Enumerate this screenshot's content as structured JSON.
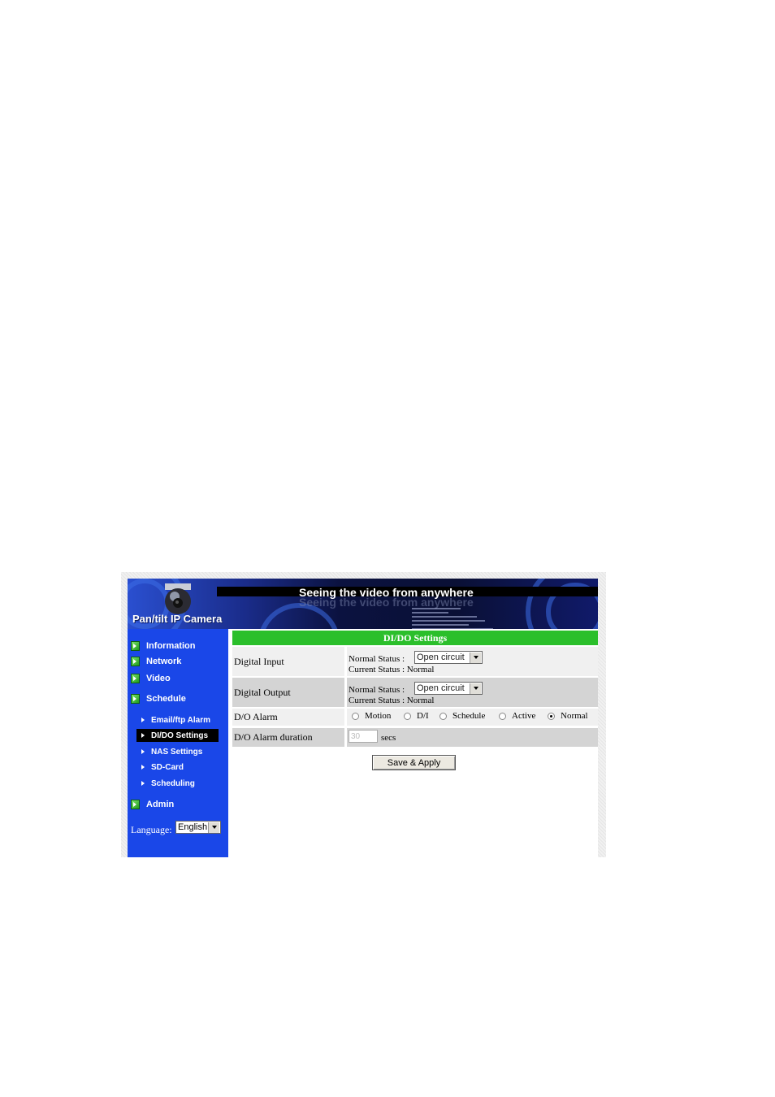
{
  "banner": {
    "headline": "Seeing the video from anywhere",
    "brand": "Pan/tilt IP Camera"
  },
  "sidebar": {
    "main_items": [
      {
        "label": "Information",
        "icon": "green-arrow-icon"
      },
      {
        "label": "Network",
        "icon": "green-arrow-icon"
      },
      {
        "label": "Video",
        "icon": "green-arrow-icon"
      },
      {
        "label": "Schedule",
        "icon": "green-arrow-icon"
      },
      {
        "label": "Admin",
        "icon": "green-arrow-icon"
      }
    ],
    "sub_items": [
      {
        "label": "Email/ftp Alarm"
      },
      {
        "label": "DI/DO Settings",
        "active": true
      },
      {
        "label": "NAS Settings"
      },
      {
        "label": "SD-Card"
      },
      {
        "label": "Scheduling"
      }
    ],
    "language_label": "Language:",
    "language_value": "English"
  },
  "settings": {
    "title": "DI/DO Settings",
    "digital_input": {
      "label": "Digital Input",
      "normal_status_label": "Normal Status :",
      "normal_status_value": "Open circuit",
      "current_status_text": "Current Status : Normal"
    },
    "digital_output": {
      "label": "Digital Output",
      "normal_status_label": "Normal Status :",
      "normal_status_value": "Open circuit",
      "current_status_text": "Current Status : Normal"
    },
    "do_alarm": {
      "label": "D/O Alarm",
      "options": [
        "Motion",
        "D/I",
        "Schedule",
        "Active",
        "Normal"
      ],
      "selected": "Normal"
    },
    "do_alarm_duration": {
      "label": "D/O Alarm duration",
      "value": "30",
      "unit": "secs"
    },
    "save_label": "Save & Apply"
  },
  "colors": {
    "sidebar_bg": "#1a47e8",
    "title_bar": "#2bbf2b",
    "active_item": "#000000"
  }
}
